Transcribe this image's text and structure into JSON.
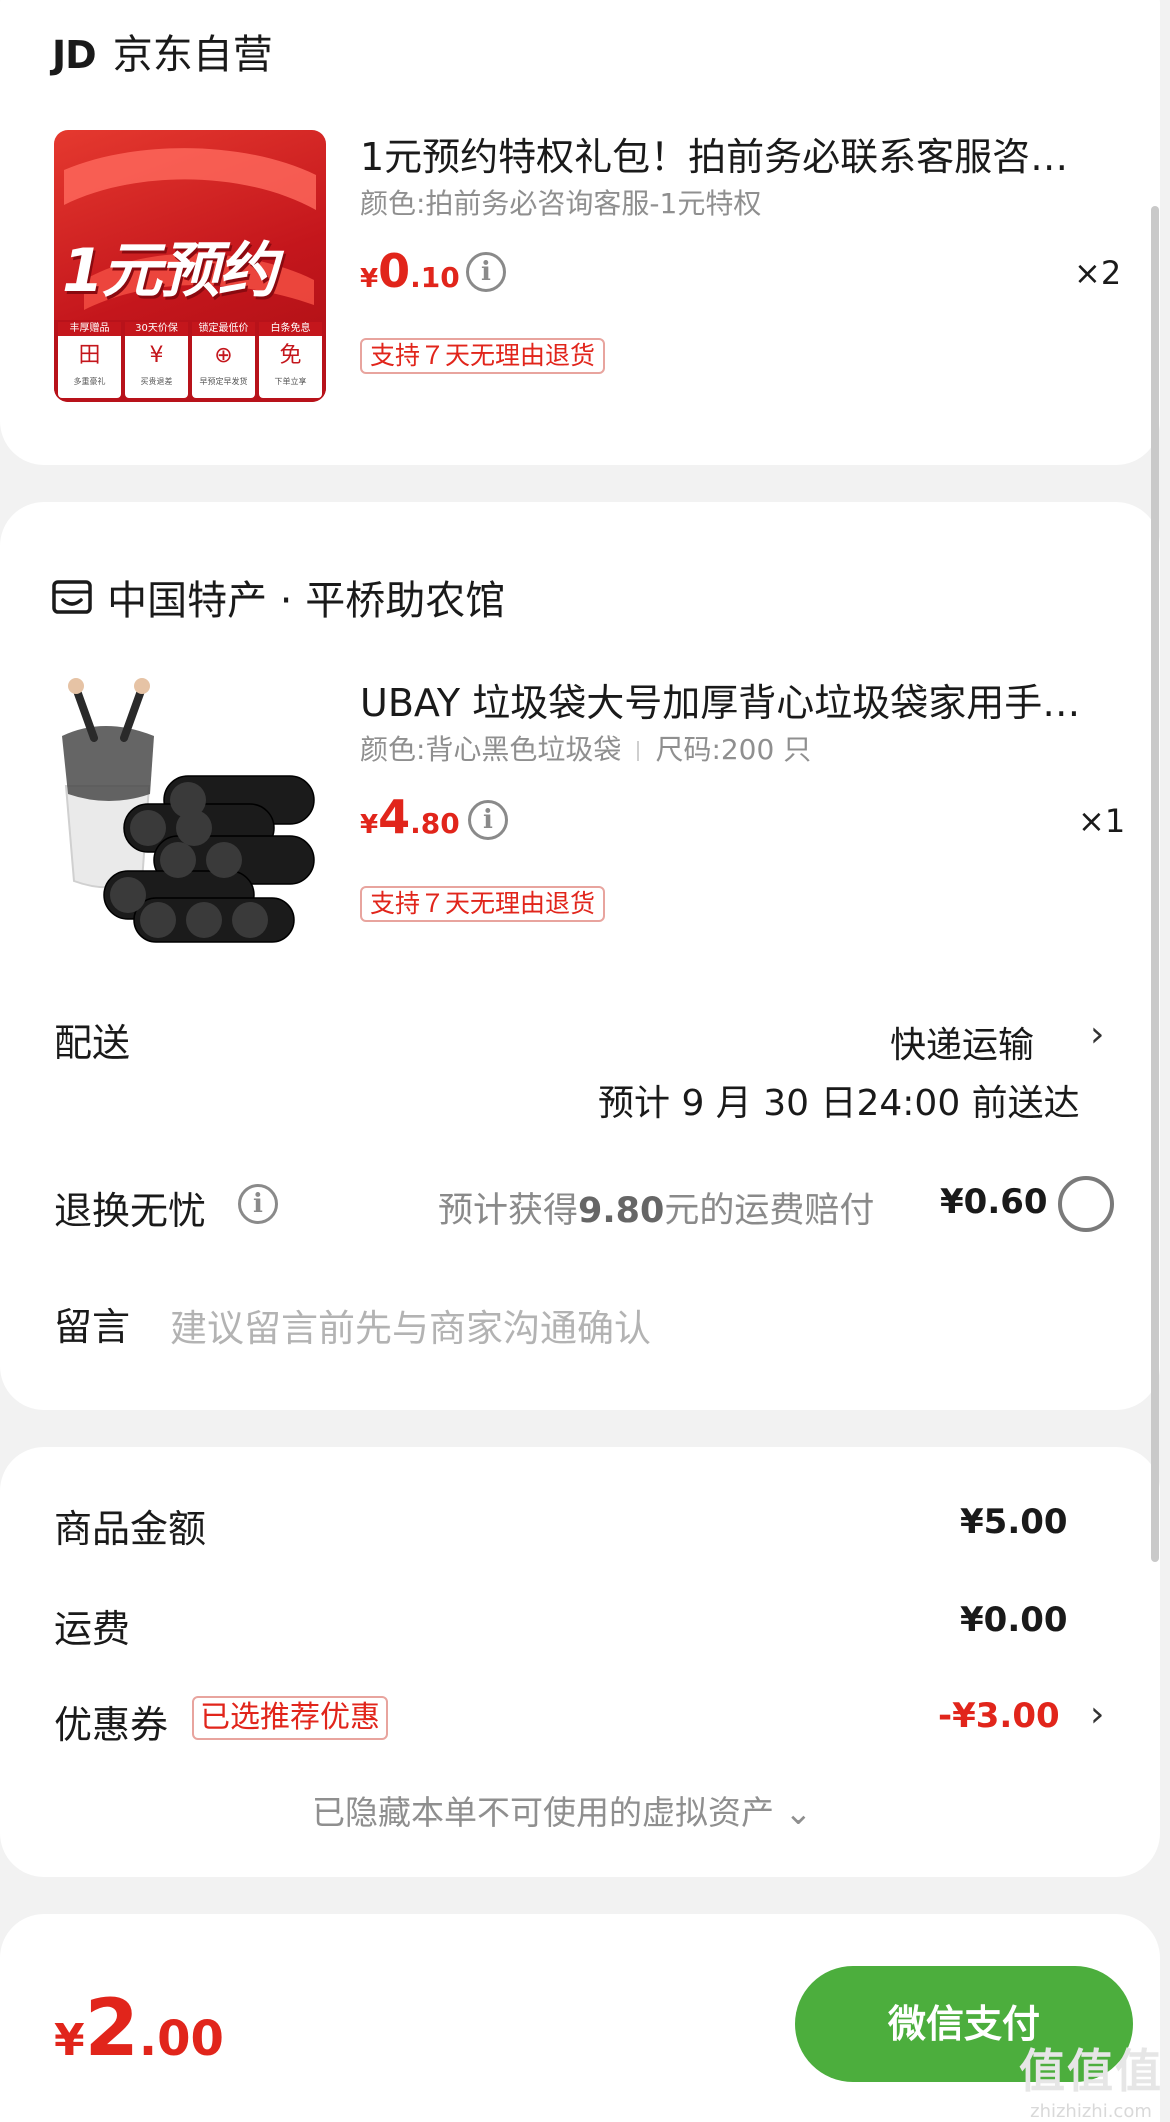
{
  "shop1": {
    "logo": "JD",
    "name": "京东自营",
    "product": {
      "title": "1元预约特权礼包！拍前务必联系客服咨…",
      "spec": "颜色:拍前务必咨询客服-1元特权",
      "price_yen": "¥",
      "price_int": "0",
      "price_dec": ".10",
      "qty": "×2",
      "tag": "支持７天无理由退货",
      "image": {
        "big_text": "1元预约",
        "badges": [
          "丰厚赠品",
          "30天价保",
          "锁定最低价",
          "白条免息"
        ],
        "badge_subs": [
          "多重豪礼",
          "买贵退差",
          "早预定早发货",
          "下单立享"
        ],
        "badge_icons": [
          "田",
          "¥",
          "⊕",
          "免"
        ]
      }
    }
  },
  "shop2": {
    "icon": "shop-icon",
    "name": "中国特产 · 平桥助农馆",
    "product": {
      "title": "UBAY 垃圾袋大号加厚背心垃圾袋家用手…",
      "spec_color": "颜色:背心黑色垃圾袋",
      "spec_size": "尺码:200 只",
      "price_yen": "¥",
      "price_int": "4",
      "price_dec": ".80",
      "qty": "×1",
      "tag": "支持７天无理由退货"
    },
    "delivery": {
      "label": "配送",
      "method": "快递运输",
      "eta": "预计 9 月 30 日24:00 前送达"
    },
    "return_worry": {
      "label": "退换无忧",
      "desc_prefix": "预计获得",
      "desc_amount": "9.80",
      "desc_suffix": "元的运费赔付",
      "price": "¥0.60"
    },
    "message": {
      "label": "留言",
      "placeholder": "建议留言前先与商家沟通确认"
    }
  },
  "summary": {
    "goods_label": "商品金额",
    "goods_value": "¥5.00",
    "shipping_label": "运费",
    "shipping_value": "¥0.00",
    "coupon_label": "优惠券",
    "coupon_tag": "已选推荐优惠",
    "coupon_value": "-¥3.00",
    "hidden_assets": "已隐藏本单不可使用的虚拟资产 ⌄"
  },
  "footer": {
    "total_yen": "¥",
    "total_int": "2",
    "total_dec": ".00",
    "pay_button": "微信支付"
  },
  "watermark": {
    "logo": "值值值",
    "url": "zhizhizhi.com"
  },
  "colors": {
    "accent_red": "#e1251b",
    "pay_green": "#4cae3d",
    "background": "#f2f2f2"
  }
}
